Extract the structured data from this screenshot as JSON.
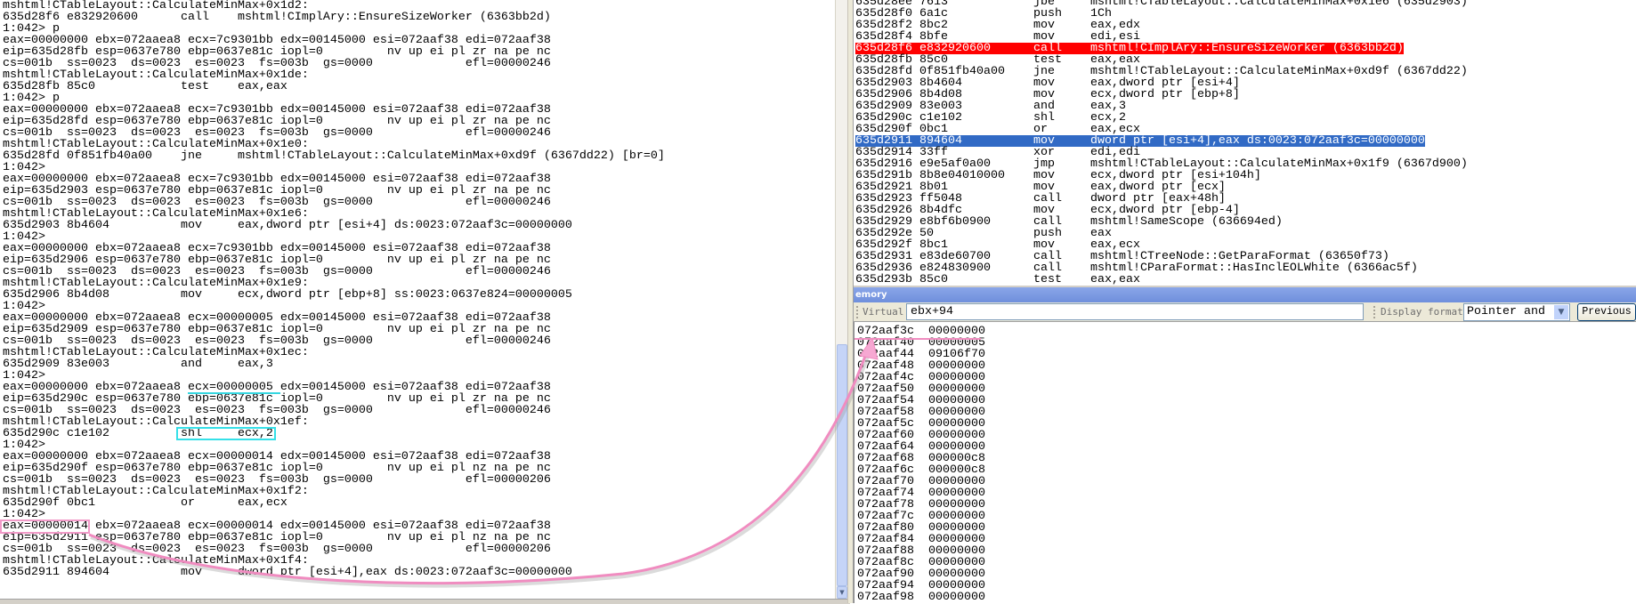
{
  "command_window": {
    "lines": [
      "mshtml!CTableLayout::CalculateMinMax+0x1d2:",
      "635d28f6 e832920600      call    mshtml!CImplAry::EnsureSizeWorker (6363bb2d)",
      "1:042> p",
      "eax=00000000 ebx=072aaea8 ecx=7c9301bb edx=00145000 esi=072aaf38 edi=072aaf38",
      "eip=635d28fb esp=0637e780 ebp=0637e81c iopl=0         nv up ei pl zr na pe nc",
      "cs=001b  ss=0023  ds=0023  es=0023  fs=003b  gs=0000             efl=00000246",
      "mshtml!CTableLayout::CalculateMinMax+0x1de:",
      "635d28fb 85c0            test    eax,eax",
      "1:042> p",
      "eax=00000000 ebx=072aaea8 ecx=7c9301bb edx=00145000 esi=072aaf38 edi=072aaf38",
      "eip=635d28fd esp=0637e780 ebp=0637e81c iopl=0         nv up ei pl zr na pe nc",
      "cs=001b  ss=0023  ds=0023  es=0023  fs=003b  gs=0000             efl=00000246",
      "mshtml!CTableLayout::CalculateMinMax+0x1e0:",
      "635d28fd 0f851fb40a00    jne     mshtml!CTableLayout::CalculateMinMax+0xd9f (6367dd22) [br=0]",
      "1:042>",
      "eax=00000000 ebx=072aaea8 ecx=7c9301bb edx=00145000 esi=072aaf38 edi=072aaf38",
      "eip=635d2903 esp=0637e780 ebp=0637e81c iopl=0         nv up ei pl zr na pe nc",
      "cs=001b  ss=0023  ds=0023  es=0023  fs=003b  gs=0000             efl=00000246",
      "mshtml!CTableLayout::CalculateMinMax+0x1e6:",
      "635d2903 8b4604          mov     eax,dword ptr [esi+4] ds:0023:072aaf3c=00000000",
      "1:042>",
      "eax=00000000 ebx=072aaea8 ecx=7c9301bb edx=00145000 esi=072aaf38 edi=072aaf38",
      "eip=635d2906 esp=0637e780 ebp=0637e81c iopl=0         nv up ei pl zr na pe nc",
      "cs=001b  ss=0023  ds=0023  es=0023  fs=003b  gs=0000             efl=00000246",
      "mshtml!CTableLayout::CalculateMinMax+0x1e9:",
      "635d2906 8b4d08          mov     ecx,dword ptr [ebp+8] ss:0023:0637e824=00000005",
      "1:042>",
      "eax=00000000 ebx=072aaea8 ecx=00000005 edx=00145000 esi=072aaf38 edi=072aaf38",
      "eip=635d2909 esp=0637e780 ebp=0637e81c iopl=0         nv up ei pl zr na pe nc",
      "cs=001b  ss=0023  ds=0023  es=0023  fs=003b  gs=0000             efl=00000246",
      "mshtml!CTableLayout::CalculateMinMax+0x1ec:",
      "635d2909 83e003          and     eax,3",
      "1:042>",
      "eax=00000000 ebx=072aaea8 ecx=00000005 edx=00145000 esi=072aaf38 edi=072aaf38",
      "eip=635d290c esp=0637e780 ebp=0637e81c iopl=0         nv up ei pl zr na pe nc",
      "cs=001b  ss=0023  ds=0023  es=0023  fs=003b  gs=0000             efl=00000246",
      "mshtml!CTableLayout::CalculateMinMax+0x1ef:",
      "635d290c c1e102          shl     ecx,2",
      "1:042>",
      "eax=00000000 ebx=072aaea8 ecx=00000014 edx=00145000 esi=072aaf38 edi=072aaf38",
      "eip=635d290f esp=0637e780 ebp=0637e81c iopl=0         nv up ei pl nz na pe nc",
      "cs=001b  ss=0023  ds=0023  es=0023  fs=003b  gs=0000             efl=00000206",
      "mshtml!CTableLayout::CalculateMinMax+0x1f2:",
      "635d290f 0bc1            or      eax,ecx",
      "1:042>",
      "eax=00000014 ebx=072aaea8 ecx=00000014 edx=00145000 esi=072aaf38 edi=072aaf38",
      "eip=635d2911 esp=0637e780 ebp=0637e81c iopl=0         nv up ei pl nz na pe nc",
      "cs=001b  ss=0023  ds=0023  es=0023  fs=003b  gs=0000             efl=00000206",
      "mshtml!CTableLayout::CalculateMinMax+0x1f4:",
      "635d2911 894604          mov     dword ptr [esi+4],eax ds:0023:072aaf3c=00000000"
    ]
  },
  "disassembly": {
    "rows": [
      {
        "addr": "635d28ee",
        "bytes": "7613",
        "mnemonic": "jbe",
        "operands": "mshtml!CTableLayout::CalculateMinMax+0x1e6 (635d2903)"
      },
      {
        "addr": "635d28f0",
        "bytes": "6a1c",
        "mnemonic": "push",
        "operands": "1Ch"
      },
      {
        "addr": "635d28f2",
        "bytes": "8bc2",
        "mnemonic": "mov",
        "operands": "eax,edx"
      },
      {
        "addr": "635d28f4",
        "bytes": "8bfe",
        "mnemonic": "mov",
        "operands": "edi,esi"
      },
      {
        "addr": "635d28f6",
        "bytes": "e832920600",
        "mnemonic": "call",
        "operands": "mshtml!CImplAry::EnsureSizeWorker (6363bb2d)",
        "highlight": "breakpoint"
      },
      {
        "addr": "635d28fb",
        "bytes": "85c0",
        "mnemonic": "test",
        "operands": "eax,eax"
      },
      {
        "addr": "635d28fd",
        "bytes": "0f851fb40a00",
        "mnemonic": "jne",
        "operands": "mshtml!CTableLayout::CalculateMinMax+0xd9f (6367dd22)"
      },
      {
        "addr": "635d2903",
        "bytes": "8b4604",
        "mnemonic": "mov",
        "operands": "eax,dword ptr [esi+4]"
      },
      {
        "addr": "635d2906",
        "bytes": "8b4d08",
        "mnemonic": "mov",
        "operands": "ecx,dword ptr [ebp+8]"
      },
      {
        "addr": "635d2909",
        "bytes": "83e003",
        "mnemonic": "and",
        "operands": "eax,3"
      },
      {
        "addr": "635d290c",
        "bytes": "c1e102",
        "mnemonic": "shl",
        "operands": "ecx,2"
      },
      {
        "addr": "635d290f",
        "bytes": "0bc1",
        "mnemonic": "or",
        "operands": "eax,ecx"
      },
      {
        "addr": "635d2911",
        "bytes": "894604",
        "mnemonic": "mov",
        "operands": "dword ptr [esi+4],eax ds:0023:072aaf3c=00000000",
        "highlight": "current"
      },
      {
        "addr": "635d2914",
        "bytes": "33ff",
        "mnemonic": "xor",
        "operands": "edi,edi"
      },
      {
        "addr": "635d2916",
        "bytes": "e9e5af0a00",
        "mnemonic": "jmp",
        "operands": "mshtml!CTableLayout::CalculateMinMax+0x1f9 (6367d900)"
      },
      {
        "addr": "635d291b",
        "bytes": "8b8e04010000",
        "mnemonic": "mov",
        "operands": "ecx,dword ptr [esi+104h]"
      },
      {
        "addr": "635d2921",
        "bytes": "8b01",
        "mnemonic": "mov",
        "operands": "eax,dword ptr [ecx]"
      },
      {
        "addr": "635d2923",
        "bytes": "ff5048",
        "mnemonic": "call",
        "operands": "dword ptr [eax+48h]"
      },
      {
        "addr": "635d2926",
        "bytes": "8b4dfc",
        "mnemonic": "mov",
        "operands": "ecx,dword ptr [ebp-4]"
      },
      {
        "addr": "635d2929",
        "bytes": "e8bf6b0900",
        "mnemonic": "call",
        "operands": "mshtml!SameScope (636694ed)"
      },
      {
        "addr": "635d292e",
        "bytes": "50",
        "mnemonic": "push",
        "operands": "eax"
      },
      {
        "addr": "635d292f",
        "bytes": "8bc1",
        "mnemonic": "mov",
        "operands": "eax,ecx"
      },
      {
        "addr": "635d2931",
        "bytes": "e83de60700",
        "mnemonic": "call",
        "operands": "mshtml!CTreeNode::GetParaFormat (63650f73)"
      },
      {
        "addr": "635d2936",
        "bytes": "e824830900",
        "mnemonic": "call",
        "operands": "mshtml!CParaFormat::HasInclEOLWhite (6366ac5f)"
      },
      {
        "addr": "635d293b",
        "bytes": "85c0",
        "mnemonic": "test",
        "operands": "eax,eax"
      }
    ],
    "colors": {
      "breakpoint": "#ff0000",
      "current": "#316ac5"
    }
  },
  "memory": {
    "title": "emory",
    "virtual_label": "Virtual:",
    "virtual_value": "ebx+94",
    "display_format_label": "Display format:",
    "display_format_value": "Pointer and",
    "previous_label": "Previous",
    "rows": [
      [
        "072aaf3c",
        "00000000"
      ],
      [
        "072aaf40",
        "00000005"
      ],
      [
        "072aaf44",
        "09106f70"
      ],
      [
        "072aaf48",
        "00000000"
      ],
      [
        "072aaf4c",
        "00000000"
      ],
      [
        "072aaf50",
        "00000000"
      ],
      [
        "072aaf54",
        "00000000"
      ],
      [
        "072aaf58",
        "00000000"
      ],
      [
        "072aaf5c",
        "00000000"
      ],
      [
        "072aaf60",
        "00000000"
      ],
      [
        "072aaf64",
        "00000000"
      ],
      [
        "072aaf68",
        "000000c8"
      ],
      [
        "072aaf6c",
        "000000c8"
      ],
      [
        "072aaf70",
        "00000000"
      ],
      [
        "072aaf74",
        "00000000"
      ],
      [
        "072aaf78",
        "00000000"
      ],
      [
        "072aaf7c",
        "00000000"
      ],
      [
        "072aaf80",
        "00000000"
      ],
      [
        "072aaf84",
        "00000000"
      ],
      [
        "072aaf88",
        "00000000"
      ],
      [
        "072aaf8c",
        "00000000"
      ],
      [
        "072aaf90",
        "00000000"
      ],
      [
        "072aaf94",
        "00000000"
      ],
      [
        "072aaf98",
        "00000000"
      ]
    ]
  },
  "annotations": {
    "cyan": "#35d6e0",
    "pink": "#f08cc0"
  }
}
